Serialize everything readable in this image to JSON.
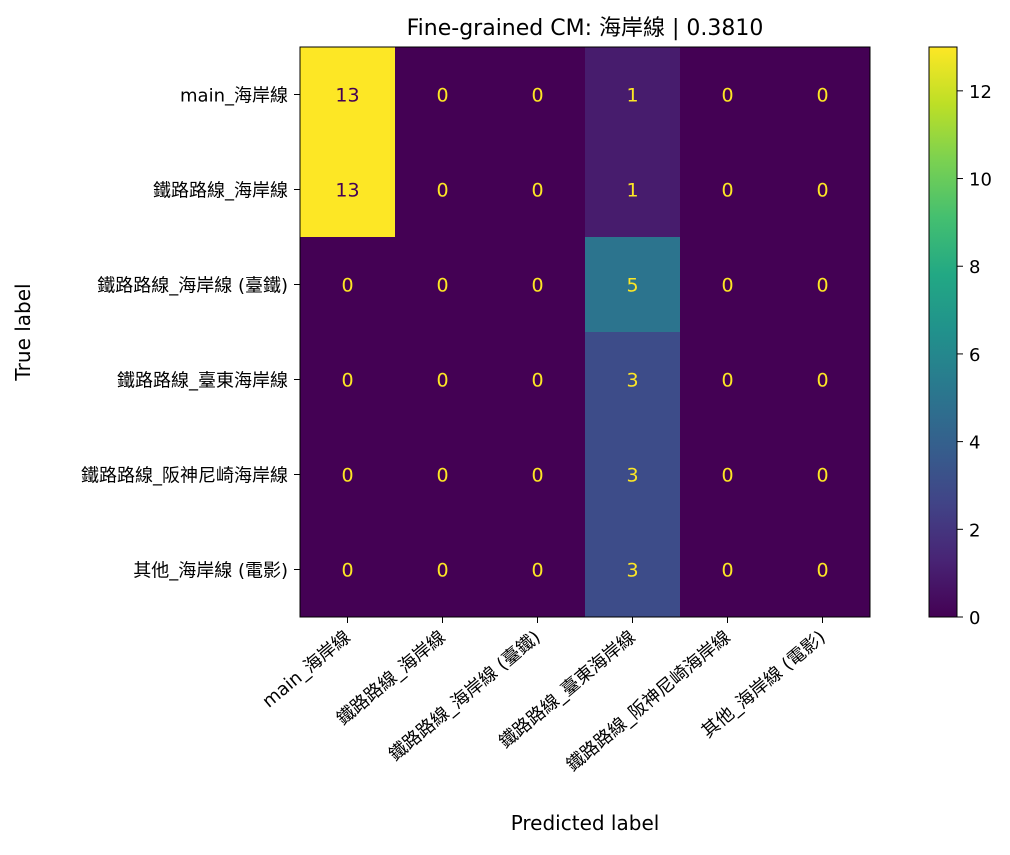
{
  "chart_data": {
    "type": "heatmap",
    "title": "Fine-grained CM: 海岸線 | 0.3810",
    "xlabel": "Predicted label",
    "ylabel": "True label",
    "x_categories": [
      "main_海岸線",
      "鐵路路線_海岸線",
      "鐵路路線_海岸線 (臺鐵)",
      "鐵路路線_臺東海岸線",
      "鐵路路線_阪神尼崎海岸線",
      "其他_海岸線 (電影)"
    ],
    "y_categories": [
      "main_海岸線",
      "鐵路路線_海岸線",
      "鐵路路線_海岸線 (臺鐵)",
      "鐵路路線_臺東海岸線",
      "鐵路路線_阪神尼崎海岸線",
      "其他_海岸線 (電影)"
    ],
    "values": [
      [
        13,
        0,
        0,
        1,
        0,
        0
      ],
      [
        13,
        0,
        0,
        1,
        0,
        0
      ],
      [
        0,
        0,
        0,
        5,
        0,
        0
      ],
      [
        0,
        0,
        0,
        3,
        0,
        0
      ],
      [
        0,
        0,
        0,
        3,
        0,
        0
      ],
      [
        0,
        0,
        0,
        3,
        0,
        0
      ]
    ],
    "colormap": "viridis",
    "vmin": 0,
    "vmax": 13,
    "colorbar_ticks": [
      0,
      2,
      4,
      6,
      8,
      10,
      12
    ],
    "text_color_dark_cell": "#fde725",
    "text_color_light_cell": "#440154",
    "grid": false
  }
}
